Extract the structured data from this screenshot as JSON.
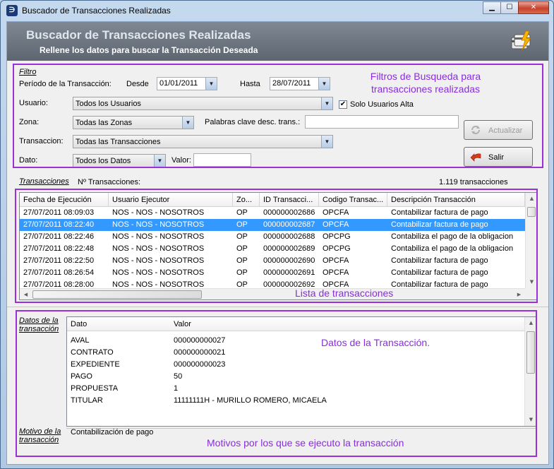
{
  "window": {
    "title": "Buscador de Transacciones Realizadas",
    "icon": "app-logo-icon",
    "buttons": {
      "minimize": "▁",
      "maximize": "☐",
      "close": "✕"
    }
  },
  "header": {
    "title": "Buscador de Transacciones Realizadas",
    "subtitle": "Rellene los datos para buscar la Transacción Deseada",
    "icon": "card-lightning-icon"
  },
  "filter": {
    "legend": "Filtro",
    "period_label": "Período de la Transacción:",
    "from_label": "Desde",
    "from_value": "01/01/2011",
    "to_label": "Hasta",
    "to_value": "28/07/2011",
    "user_label": "Usuario:",
    "user_value": "Todos los Usuarios",
    "only_high_users_label": "Solo Usuarios Alta",
    "only_high_users_checked": true,
    "zone_label": "Zona:",
    "zone_value": "Todas las Zonas",
    "keywords_label": "Palabras clave desc. trans.:",
    "keywords_value": "",
    "transaction_label": "Transaccion:",
    "transaction_value": "Todas las Transacciones",
    "data_label": "Dato:",
    "data_value": "Todos los Datos",
    "value_label": "Valor:",
    "value_value": "",
    "update_button": "Actualizar",
    "exit_button": "Salir"
  },
  "transactions": {
    "legend": "Transacciones",
    "count_label": "Nº Transacciones:",
    "count_value": "1.119 transacciones",
    "columns": [
      "Fecha de Ejecución",
      "Usuario Ejecutor",
      "Zo...",
      "ID Transacci...",
      "Codigo Transac...",
      "Descripción Transacción"
    ],
    "rows": [
      [
        "27/07/2011 08:09:03",
        "NOS - NOS - NOSOTROS",
        "OP",
        "000000002686",
        "OPCFA",
        "Contabilizar factura de pago"
      ],
      [
        "27/07/2011 08:22:40",
        "NOS - NOS - NOSOTROS",
        "OP",
        "000000002687",
        "OPCFA",
        "Contabilizar factura de pago"
      ],
      [
        "27/07/2011 08:22:46",
        "NOS - NOS - NOSOTROS",
        "OP",
        "000000002688",
        "OPCPG",
        "Contabiliza el pago de la obligacion"
      ],
      [
        "27/07/2011 08:22:48",
        "NOS - NOS - NOSOTROS",
        "OP",
        "000000002689",
        "OPCPG",
        "Contabiliza el pago de la obligacion"
      ],
      [
        "27/07/2011 08:22:50",
        "NOS - NOS - NOSOTROS",
        "OP",
        "000000002690",
        "OPCFA",
        "Contabilizar factura de pago"
      ],
      [
        "27/07/2011 08:26:54",
        "NOS - NOS - NOSOTROS",
        "OP",
        "000000002691",
        "OPCFA",
        "Contabilizar factura de pago"
      ],
      [
        "27/07/2011 08:28:00",
        "NOS - NOS - NOSOTROS",
        "OP",
        "000000002692",
        "OPCFA",
        "Contabilizar factura de pago"
      ]
    ],
    "selected_row": 1
  },
  "details": {
    "legend_line1": "Datos de la",
    "legend_line2": "transacción",
    "columns": [
      "Dato",
      "Valor"
    ],
    "rows": [
      [
        "AVAL",
        "000000000027"
      ],
      [
        "CONTRATO",
        "000000000021"
      ],
      [
        "EXPEDIENTE",
        "000000000023"
      ],
      [
        "PAGO",
        "50"
      ],
      [
        "PROPUESTA",
        "1"
      ],
      [
        "TITULAR",
        "11111111H - MURILLO ROMERO, MICAELA"
      ]
    ]
  },
  "reason": {
    "legend_line1": "Motivo de la",
    "legend_line2": "transacción",
    "value": "Contabilización de pago"
  },
  "annotations": {
    "filters_line1": "Filtros de Busqueda para",
    "filters_line2": "transacciones realizadas",
    "list": "Lista de transacciones",
    "data": "Datos de la Transacción.",
    "reasons": "Motivos por los que se ejecuto la transacción",
    "color": "#9b30d9"
  }
}
